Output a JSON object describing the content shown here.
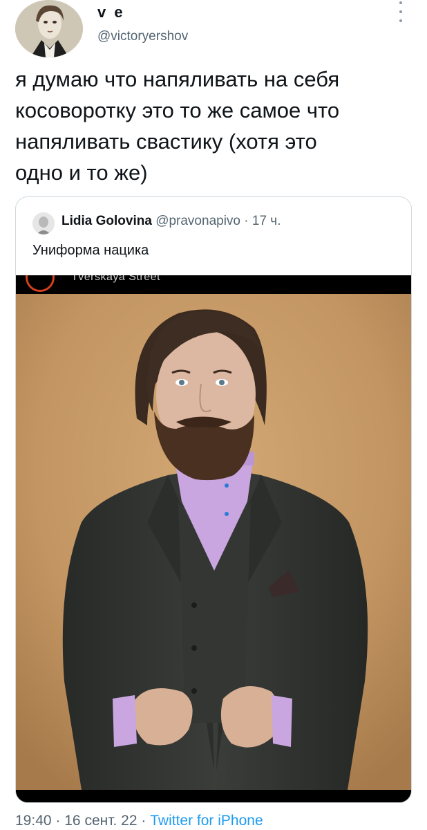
{
  "author": {
    "display_name": "v e",
    "handle": "@victoryershov"
  },
  "tweet": {
    "lines": [
      "я думаю что напяливать на себя",
      "косоворотку это то же самое что",
      "напяливать свастику (хотя это",
      "одно и то же)"
    ]
  },
  "quote": {
    "name": "Lidia Golovina",
    "handle": "@pravonapivo",
    "separator": "·",
    "time": "17 ч.",
    "text": "Униформа нацика",
    "media_caption": "Tverskaya Street"
  },
  "footer": {
    "time": "19:40",
    "date": "16 сент. 22",
    "separator": "·",
    "source": "Twitter for iPhone"
  },
  "icons": {
    "more": "more-vertical-icon"
  },
  "colors": {
    "text": "#0f1419",
    "secondary": "#536471",
    "link": "#1d9bf0",
    "border": "#cfd9de",
    "photo_background": "#c29562",
    "shirt": "#c9a6e0",
    "suit": "#2f322f"
  }
}
